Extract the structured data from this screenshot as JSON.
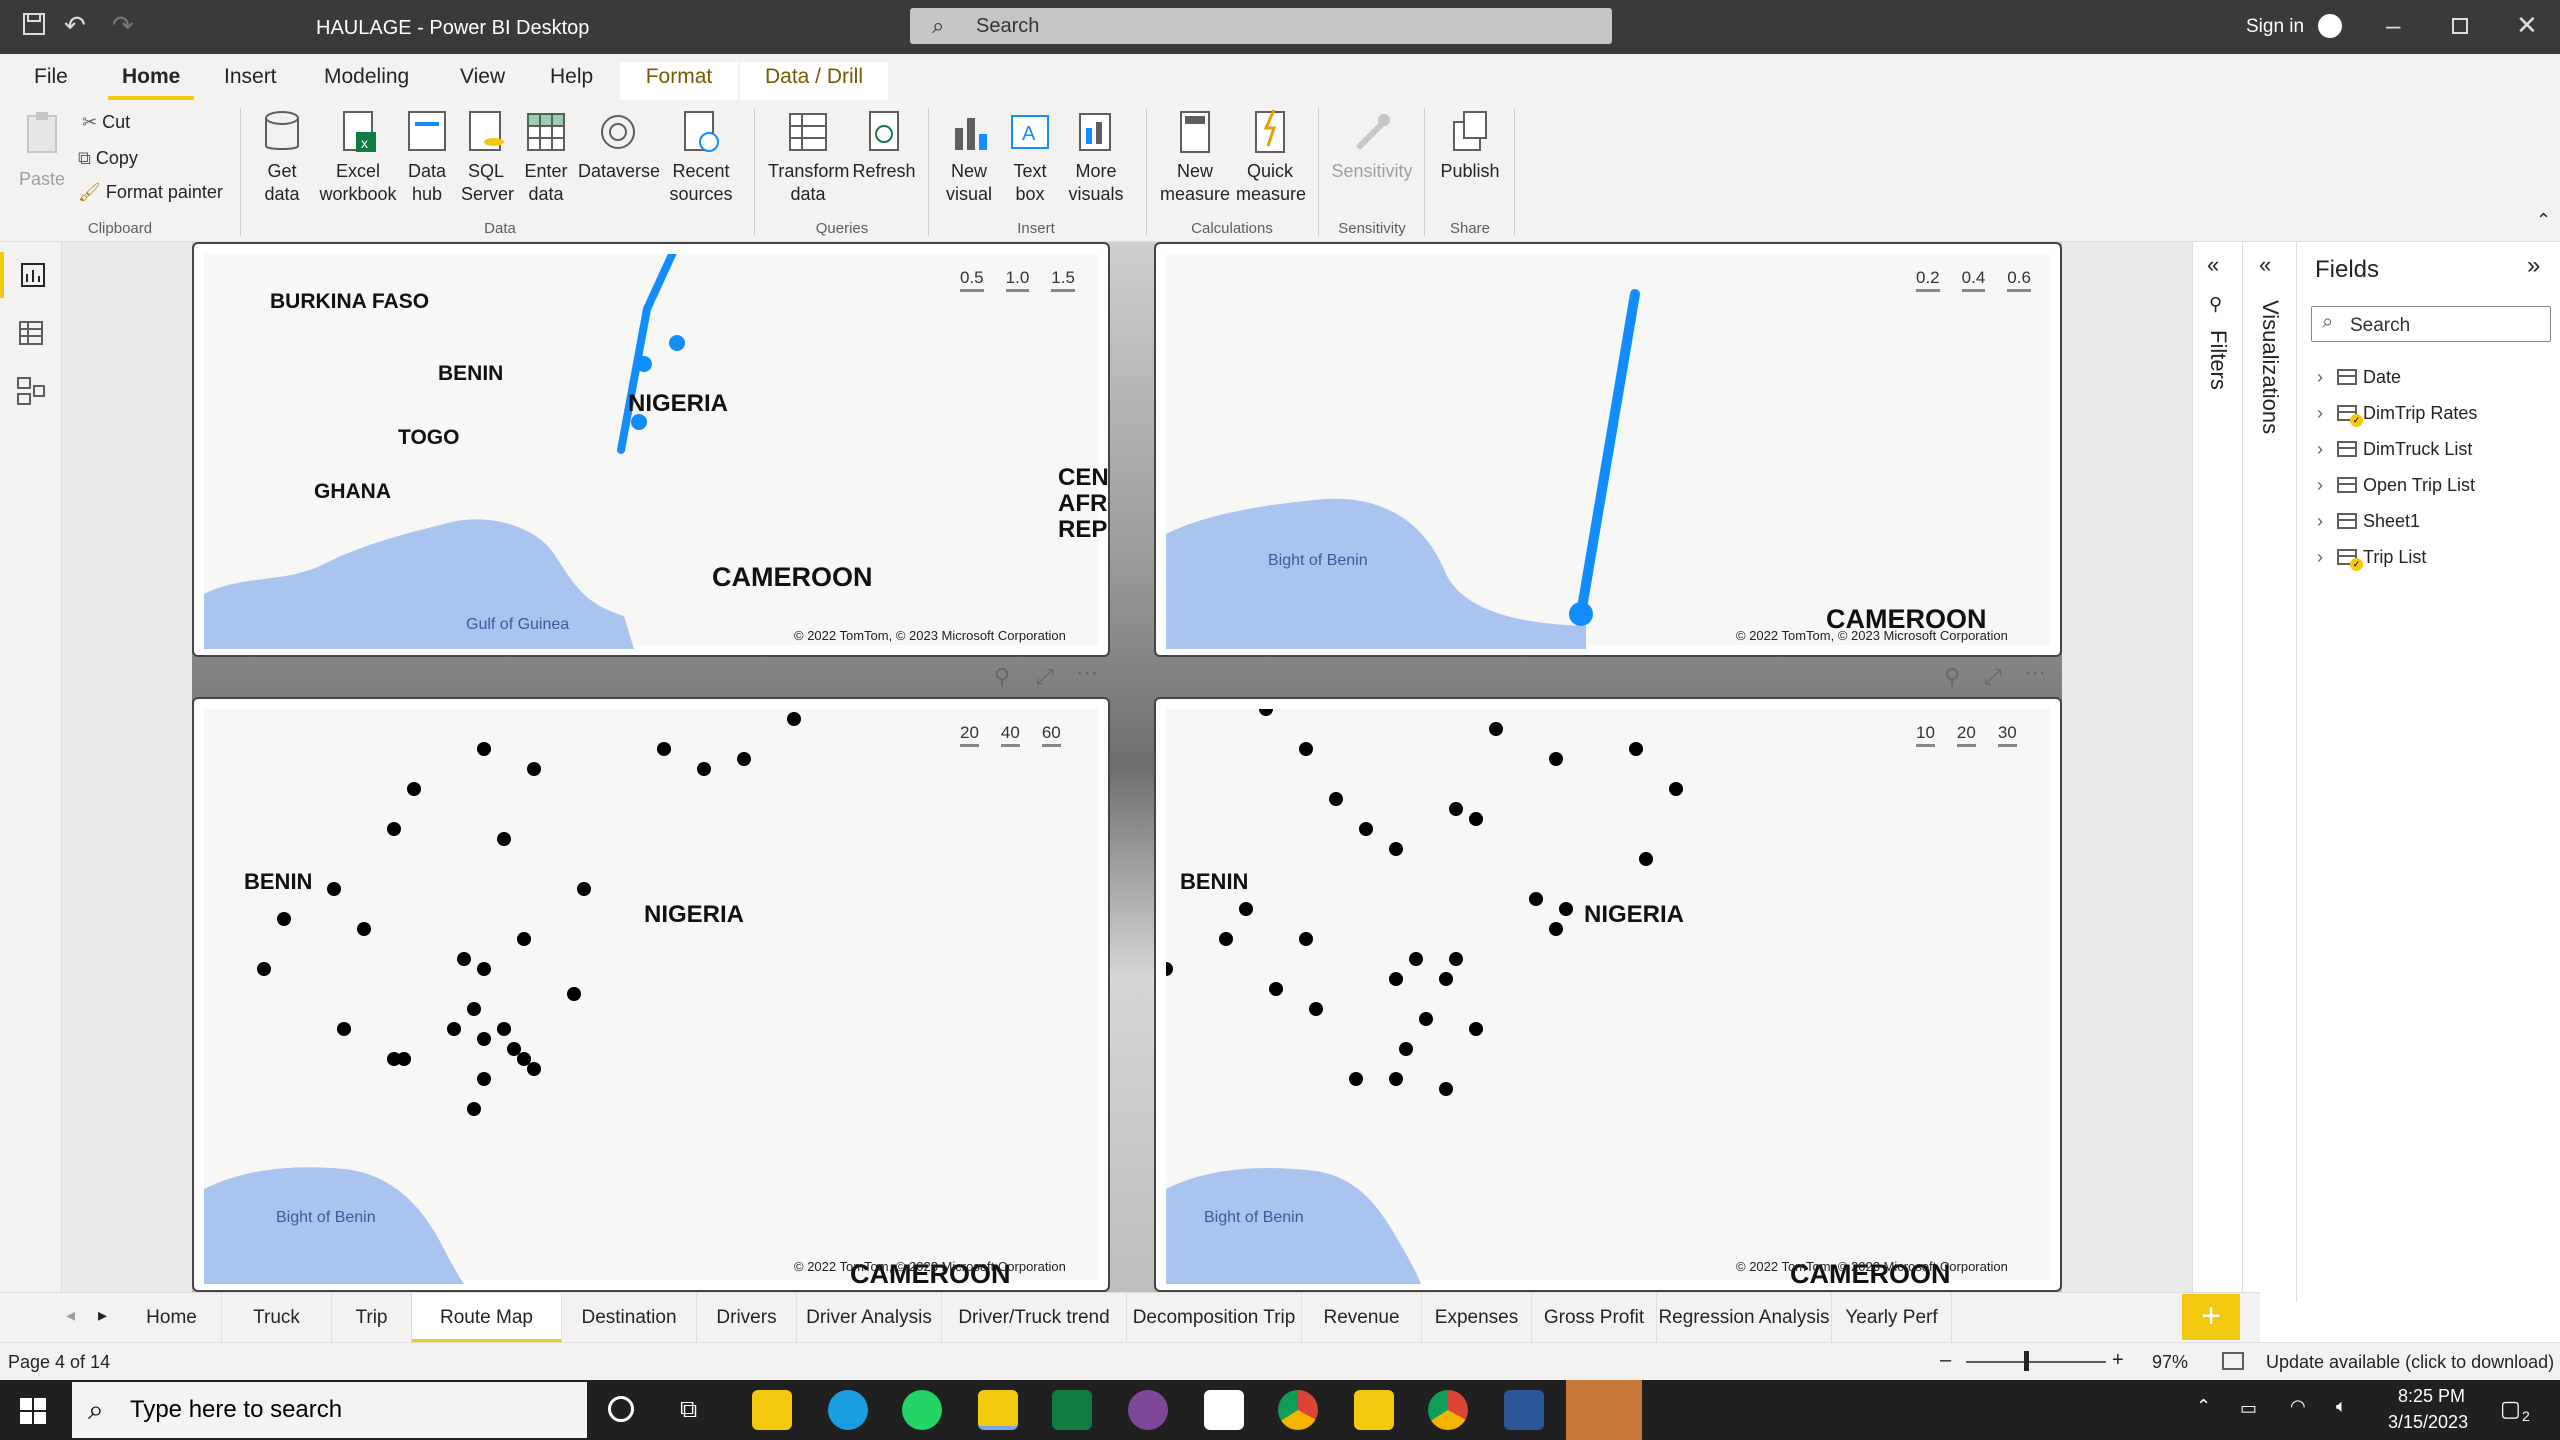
{
  "title_bar": {
    "title": "HAULAGE - Power BI Desktop",
    "search_placeholder": "Search",
    "sign_in": "Sign in"
  },
  "menu": {
    "tabs": [
      "File",
      "Home",
      "Insert",
      "Modeling",
      "View",
      "Help",
      "Format",
      "Data / Drill"
    ],
    "active": "Home"
  },
  "ribbon": {
    "paste": "Paste",
    "cut": "Cut",
    "copy": "Copy",
    "format_painter": "Format painter",
    "clipboard": "Clipboard",
    "get_data": "Get data",
    "excel": "Excel workbook",
    "data_hub": "Data hub",
    "sql": "SQL Server",
    "enter_data": "Enter data",
    "dataverse": "Dataverse",
    "recent": "Recent sources",
    "data_group": "Data",
    "transform": "Transform data",
    "refresh": "Refresh",
    "queries": "Queries",
    "new_visual": "New visual",
    "text_box": "Text box",
    "more_visuals": "More visuals",
    "insert": "Insert",
    "new_measure": "New measure",
    "quick_measure": "Quick measure",
    "calculations": "Calculations",
    "sensitivity_btn": "Sensitivity",
    "sensitivity": "Sensitivity",
    "publish": "Publish",
    "share": "Share"
  },
  "visuals": {
    "v1": {
      "scale": [
        "0.5",
        "1.0",
        "1.5"
      ],
      "labels": [
        "BURKINA FASO",
        "BENIN",
        "NIGERIA",
        "TOGO",
        "GHANA",
        "CAMEROON",
        "CEN",
        "AFR",
        "REP"
      ],
      "sea": "Gulf of Guinea",
      "copyright": "© 2022 TomTom, © 2023 Microsoft Corporation"
    },
    "v2": {
      "scale": [
        "0.2",
        "0.4",
        "0.6"
      ],
      "labels": [
        "CAMEROON"
      ],
      "sea": "Bight of Benin",
      "copyright": "© 2022 TomTom, © 2023 Microsoft Corporation"
    },
    "v3": {
      "scale": [
        "20",
        "40",
        "60"
      ],
      "labels": [
        "BENIN",
        "NIGERIA",
        "CAMEROON"
      ],
      "sea": "Bight of Benin",
      "copyright": "© 2022 TomTom, © 2023 Microsoft Corporation"
    },
    "v4": {
      "scale": [
        "10",
        "20",
        "30"
      ],
      "labels": [
        "BENIN",
        "NIGERIA",
        "CAMEROON"
      ],
      "sea": "Bight of Benin",
      "copyright": "© 2022 TomTom, © 2023 Microsoft Corporation"
    }
  },
  "panes": {
    "filters": "Filters",
    "visualizations": "Visualizations",
    "fields": "Fields",
    "search_placeholder": "Search",
    "field_items": [
      "Date",
      "DimTrip Rates",
      "DimTruck List",
      "Open Trip List",
      "Sheet1",
      "Trip List"
    ]
  },
  "pages": [
    "Home",
    "Truck",
    "Trip",
    "Route Map",
    "Destination",
    "Drivers",
    "Driver Analysis",
    "Driver/Truck trend",
    "Decomposition Trip",
    "Revenue",
    "Expenses",
    "Gross Profit",
    "Regression Analysis",
    "Yearly Perf"
  ],
  "active_page": "Route Map",
  "status": {
    "page": "Page 4 of 14",
    "zoom": "97%",
    "update": "Update available (click to download)"
  },
  "taskbar": {
    "search_placeholder": "Type here to search",
    "time": "8:25 PM",
    "date": "3/15/2023",
    "notifications": "2"
  },
  "colors": {
    "accent": "#f2c811",
    "route": "#118dff",
    "water": "#a8c4ef"
  }
}
